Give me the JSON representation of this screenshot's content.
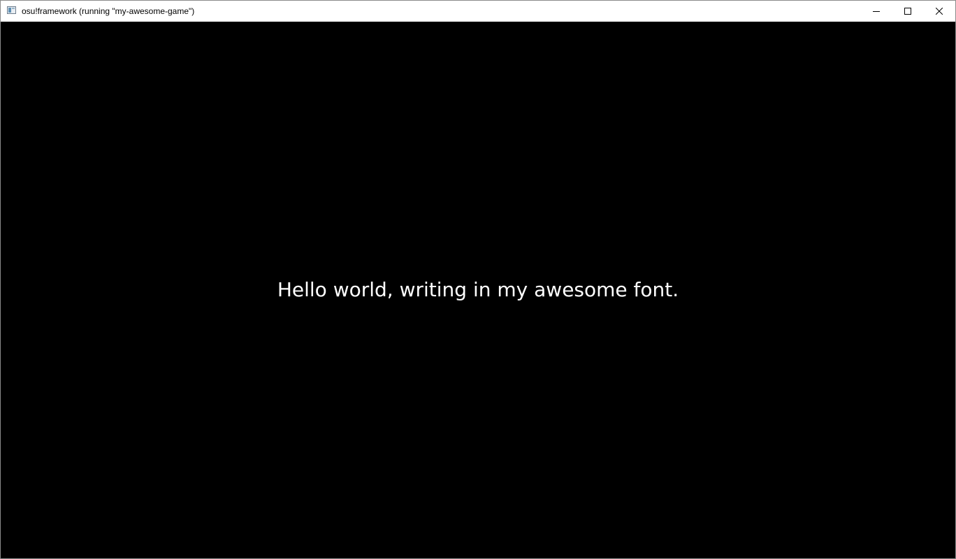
{
  "window": {
    "title": "osu!framework (running \"my-awesome-game\")",
    "app_icon": "window-app-icon",
    "controls": {
      "minimize_icon": "minimize-icon",
      "maximize_icon": "maximize-icon",
      "close_icon": "close-icon"
    }
  },
  "game": {
    "text": "Hello world, writing in my awesome font.",
    "background_color": "#000000",
    "text_color": "#ffffff"
  }
}
